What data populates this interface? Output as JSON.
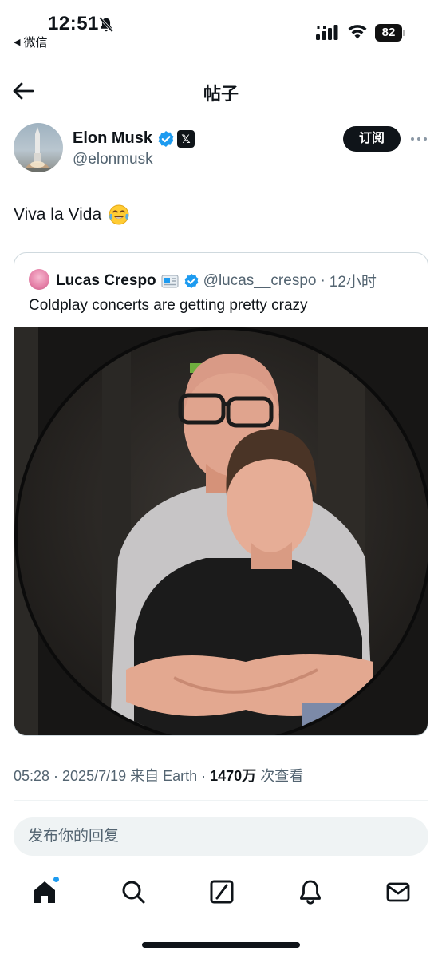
{
  "status_bar": {
    "time": "12:51",
    "back_app": "微信",
    "battery": "82"
  },
  "nav": {
    "title": "帖子"
  },
  "post": {
    "author_name": "Elon Musk",
    "author_handle": "@elonmusk",
    "x_badge": "𝕏",
    "subscribe_label": "订阅",
    "text": "Viva la Vida",
    "emoji": "face-with-tears-of-joy-icon",
    "quote": {
      "name": "Lucas Crespo",
      "handle": "@lucas__crespo",
      "separator": "·",
      "time": "12小时",
      "text": "Coldplay concerts are getting pretty crazy"
    },
    "meta": {
      "timestamp": "05:28 · 2025/7/19 来自 Earth · ",
      "views": "1470万",
      "views_suffix": " 次查看"
    }
  },
  "reply": {
    "placeholder": "发布你的回复"
  },
  "tabbar": {
    "items": [
      "home-icon",
      "search-icon",
      "grok-icon",
      "notifications-icon",
      "messages-icon"
    ],
    "home_has_dot": true
  },
  "colors": {
    "text": "#0f1419",
    "secondary": "#536471",
    "accent": "#1d9bf0",
    "border": "#cfd9de"
  }
}
